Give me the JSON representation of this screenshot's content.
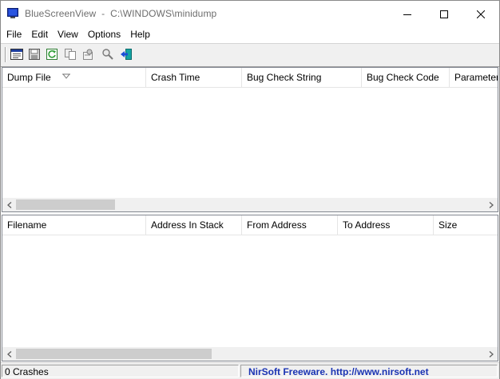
{
  "window": {
    "title": "BlueScreenView  -  C:\\WINDOWS\\minidump"
  },
  "menu": [
    {
      "label": "File"
    },
    {
      "label": "Edit"
    },
    {
      "label": "View"
    },
    {
      "label": "Options"
    },
    {
      "label": "Help"
    }
  ],
  "toolbar": {
    "buttons": [
      {
        "icon": "properties-html-report-icon"
      },
      {
        "icon": "save-icon"
      },
      {
        "icon": "refresh-icon"
      },
      {
        "icon": "copy-icon"
      },
      {
        "icon": "advanced-options-icon"
      },
      {
        "icon": "find-icon"
      },
      {
        "icon": "exit-icon"
      }
    ]
  },
  "top_pane": {
    "columns": [
      {
        "label": "Dump File",
        "sorted": "ascending"
      },
      {
        "label": "Crash Time"
      },
      {
        "label": "Bug Check String"
      },
      {
        "label": "Bug Check Code"
      },
      {
        "label": "Parameter"
      }
    ],
    "rows": []
  },
  "bottom_pane": {
    "columns": [
      {
        "label": "Filename"
      },
      {
        "label": "Address In Stack"
      },
      {
        "label": "From Address"
      },
      {
        "label": "To Address"
      },
      {
        "label": "Size"
      }
    ],
    "rows": []
  },
  "status": {
    "left": "0 Crashes",
    "right": "NirSoft Freeware.  http://www.nirsoft.net"
  },
  "colors": {
    "status_link": "#1a33b3",
    "title_text": "#6d6d6d"
  }
}
